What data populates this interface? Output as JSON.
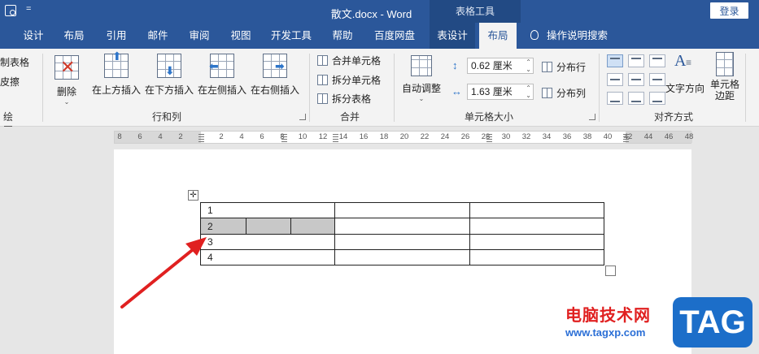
{
  "titlebar": {
    "quick_access_more": "=",
    "title": "散文.docx  -  Word",
    "context_tools": "表格工具",
    "login_label": "登录"
  },
  "tabs": [
    {
      "label": "设计"
    },
    {
      "label": "布局"
    },
    {
      "label": "引用"
    },
    {
      "label": "邮件"
    },
    {
      "label": "审阅"
    },
    {
      "label": "视图"
    },
    {
      "label": "开发工具"
    },
    {
      "label": "帮助"
    },
    {
      "label": "百度网盘"
    },
    {
      "label": "表设计"
    },
    {
      "label": "布局"
    }
  ],
  "tell_me": "操作说明搜索",
  "ribbon": {
    "draw": {
      "draw_table": "制表格",
      "eraser": "皮擦",
      "label": "绘图"
    },
    "rows_cols": {
      "delete": "删除",
      "insert_above": "在上方插入",
      "insert_below": "在下方插入",
      "insert_left": "在左侧插入",
      "insert_right": "在右侧插入",
      "label": "行和列"
    },
    "merge": {
      "merge_cells": "合并单元格",
      "split_cells": "拆分单元格",
      "split_table": "拆分表格",
      "label": "合并"
    },
    "cell_size": {
      "autofit": "自动调整",
      "height_value": "0.62 厘米",
      "width_value": "1.63 厘米",
      "distribute_rows": "分布行",
      "distribute_cols": "分布列",
      "label": "单元格大小"
    },
    "alignment": {
      "text_direction": "文字方向",
      "cell_margins": "单元格边距",
      "label": "对齐方式"
    }
  },
  "ruler": {
    "left_numbers": [
      "8",
      "6",
      "4",
      "2"
    ],
    "right_numbers": [
      "2",
      "4",
      "6",
      "8",
      "10",
      "12",
      "14",
      "16",
      "18",
      "20",
      "22",
      "24",
      "26",
      "28",
      "30",
      "32",
      "34",
      "36",
      "38",
      "40",
      "42",
      "44",
      "46",
      "48"
    ]
  },
  "table": {
    "rows": [
      {
        "first": "1"
      },
      {
        "first": "2"
      },
      {
        "first": "3"
      },
      {
        "first": "4"
      }
    ]
  },
  "watermark": {
    "text": "电脑技术网",
    "url": "www.tagxp.com",
    "badge": "TAG"
  }
}
